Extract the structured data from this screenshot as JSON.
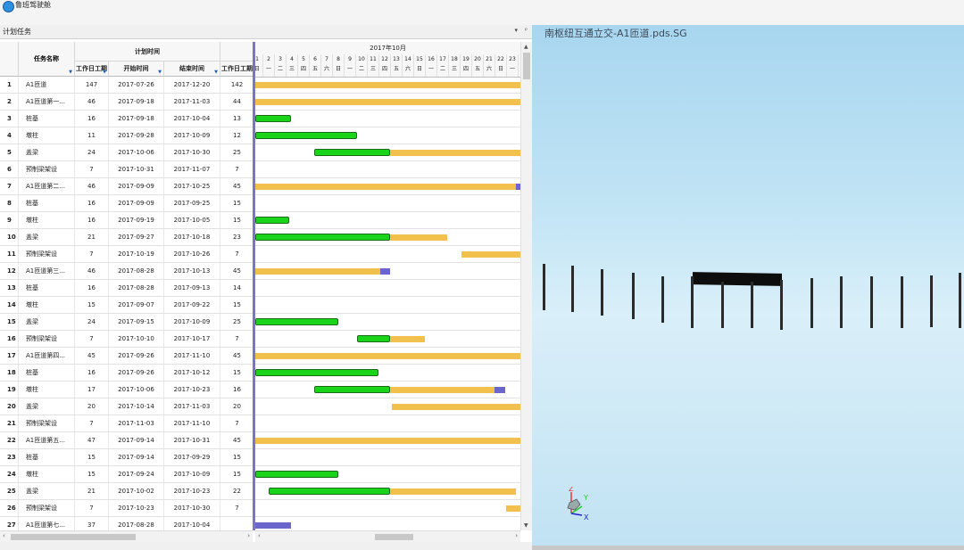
{
  "app": {
    "title": "鲁班驾驶舱"
  },
  "panel": {
    "title": "计划任务",
    "dropdown_icon": "▾",
    "pin_icon": "ᵖ"
  },
  "columns": {
    "num": "",
    "name": "任务名称",
    "plan_group": "计划时间",
    "workdays": "工作日工期",
    "start": "开始时间",
    "end": "结束时间",
    "workdays2": "工作日工期"
  },
  "rows": [
    {
      "num": "1",
      "name": "A1匝道",
      "wd": "147",
      "start": "2017-07-26",
      "end": "2017-12-20",
      "wd2": "142"
    },
    {
      "num": "2",
      "name": "A1匝道第一...",
      "wd": "46",
      "start": "2017-09-18",
      "end": "2017-11-03",
      "wd2": "44"
    },
    {
      "num": "3",
      "name": "桩基",
      "wd": "16",
      "start": "2017-09-18",
      "end": "2017-10-04",
      "wd2": "13"
    },
    {
      "num": "4",
      "name": "墩柱",
      "wd": "11",
      "start": "2017-09-28",
      "end": "2017-10-09",
      "wd2": "12"
    },
    {
      "num": "5",
      "name": "盖梁",
      "wd": "24",
      "start": "2017-10-06",
      "end": "2017-10-30",
      "wd2": "25"
    },
    {
      "num": "6",
      "name": "预制梁架设",
      "wd": "7",
      "start": "2017-10-31",
      "end": "2017-11-07",
      "wd2": "7"
    },
    {
      "num": "7",
      "name": "A1匝道第二...",
      "wd": "46",
      "start": "2017-09-09",
      "end": "2017-10-25",
      "wd2": "45"
    },
    {
      "num": "8",
      "name": "桩基",
      "wd": "16",
      "start": "2017-09-09",
      "end": "2017-09-25",
      "wd2": "15"
    },
    {
      "num": "9",
      "name": "墩柱",
      "wd": "16",
      "start": "2017-09-19",
      "end": "2017-10-05",
      "wd2": "15"
    },
    {
      "num": "10",
      "name": "盖梁",
      "wd": "21",
      "start": "2017-09-27",
      "end": "2017-10-18",
      "wd2": "23"
    },
    {
      "num": "11",
      "name": "预制梁架设",
      "wd": "7",
      "start": "2017-10-19",
      "end": "2017-10-26",
      "wd2": "7"
    },
    {
      "num": "12",
      "name": "A1匝道第三...",
      "wd": "46",
      "start": "2017-08-28",
      "end": "2017-10-13",
      "wd2": "45"
    },
    {
      "num": "13",
      "name": "桩基",
      "wd": "16",
      "start": "2017-08-28",
      "end": "2017-09-13",
      "wd2": "14"
    },
    {
      "num": "14",
      "name": "墩柱",
      "wd": "15",
      "start": "2017-09-07",
      "end": "2017-09-22",
      "wd2": "15"
    },
    {
      "num": "15",
      "name": "盖梁",
      "wd": "24",
      "start": "2017-09-15",
      "end": "2017-10-09",
      "wd2": "25"
    },
    {
      "num": "16",
      "name": "预制梁架设",
      "wd": "7",
      "start": "2017-10-10",
      "end": "2017-10-17",
      "wd2": "7"
    },
    {
      "num": "17",
      "name": "A1匝道第四...",
      "wd": "45",
      "start": "2017-09-26",
      "end": "2017-11-10",
      "wd2": "45"
    },
    {
      "num": "18",
      "name": "桩基",
      "wd": "16",
      "start": "2017-09-26",
      "end": "2017-10-12",
      "wd2": "15"
    },
    {
      "num": "19",
      "name": "墩柱",
      "wd": "17",
      "start": "2017-10-06",
      "end": "2017-10-23",
      "wd2": "16"
    },
    {
      "num": "20",
      "name": "盖梁",
      "wd": "20",
      "start": "2017-10-14",
      "end": "2017-11-03",
      "wd2": "20"
    },
    {
      "num": "21",
      "name": "预制梁架设",
      "wd": "7",
      "start": "2017-11-03",
      "end": "2017-11-10",
      "wd2": "7"
    },
    {
      "num": "22",
      "name": "A1匝道第五...",
      "wd": "47",
      "start": "2017-09-14",
      "end": "2017-10-31",
      "wd2": "45"
    },
    {
      "num": "23",
      "name": "桩基",
      "wd": "15",
      "start": "2017-09-14",
      "end": "2017-09-29",
      "wd2": "15"
    },
    {
      "num": "24",
      "name": "墩柱",
      "wd": "15",
      "start": "2017-09-24",
      "end": "2017-10-09",
      "wd2": "15"
    },
    {
      "num": "25",
      "name": "盖梁",
      "wd": "21",
      "start": "2017-10-02",
      "end": "2017-10-23",
      "wd2": "22"
    },
    {
      "num": "26",
      "name": "预制梁架设",
      "wd": "7",
      "start": "2017-10-23",
      "end": "2017-10-30",
      "wd2": "7"
    },
    {
      "num": "27",
      "name": "A1匝道第七...",
      "wd": "37",
      "start": "2017-08-28",
      "end": "2017-10-04",
      "wd2": ""
    }
  ],
  "gantt": {
    "month_label": "2017年10月",
    "days": [
      {
        "d": "1",
        "w": "日"
      },
      {
        "d": "2",
        "w": "一"
      },
      {
        "d": "3",
        "w": "二"
      },
      {
        "d": "4",
        "w": "三"
      },
      {
        "d": "5",
        "w": "四"
      },
      {
        "d": "6",
        "w": "五"
      },
      {
        "d": "7",
        "w": "六"
      },
      {
        "d": "8",
        "w": "日"
      },
      {
        "d": "9",
        "w": "一"
      },
      {
        "d": "10",
        "w": "二"
      },
      {
        "d": "11",
        "w": "三"
      },
      {
        "d": "12",
        "w": "四"
      },
      {
        "d": "13",
        "w": "五"
      },
      {
        "d": "14",
        "w": "六"
      },
      {
        "d": "15",
        "w": "日"
      },
      {
        "d": "16",
        "w": "一"
      },
      {
        "d": "17",
        "w": "二"
      },
      {
        "d": "18",
        "w": "三"
      },
      {
        "d": "19",
        "w": "四"
      },
      {
        "d": "20",
        "w": "五"
      },
      {
        "d": "21",
        "w": "六"
      },
      {
        "d": "22",
        "w": "日"
      },
      {
        "d": "23",
        "w": "一"
      }
    ],
    "legend_colors": {
      "planned": "#f2c04c",
      "actual": "#19d419",
      "delay": "#6b66cc"
    },
    "bars": [
      [
        {
          "t": "y",
          "from": 1,
          "to": 24
        }
      ],
      [
        {
          "t": "y",
          "from": 1,
          "to": 24
        }
      ],
      [
        {
          "t": "g",
          "from": 1,
          "to": 4.2
        }
      ],
      [
        {
          "t": "g",
          "from": 1,
          "to": 9.9
        }
      ],
      [
        {
          "t": "g",
          "from": 6.2,
          "to": 12.8
        },
        {
          "t": "y",
          "from": 12.8,
          "to": 24
        }
      ],
      [],
      [
        {
          "t": "y",
          "from": 1,
          "to": 23.6
        },
        {
          "t": "p",
          "from": 23.6,
          "to": 24
        }
      ],
      [],
      [
        {
          "t": "g",
          "from": 1,
          "to": 4.1
        }
      ],
      [
        {
          "t": "g",
          "from": 1,
          "to": 12.8
        },
        {
          "t": "y",
          "from": 12.8,
          "to": 17.7
        }
      ],
      [
        {
          "t": "y",
          "from": 18.9,
          "to": 24
        }
      ],
      [
        {
          "t": "y",
          "from": 1,
          "to": 11.9
        },
        {
          "t": "p",
          "from": 11.9,
          "to": 12.8
        }
      ],
      [],
      [],
      [
        {
          "t": "g",
          "from": 1,
          "to": 8.3
        }
      ],
      [
        {
          "t": "g",
          "from": 9.9,
          "to": 12.8
        },
        {
          "t": "y",
          "from": 12.8,
          "to": 15.8
        }
      ],
      [
        {
          "t": "y",
          "from": 1,
          "to": 24
        }
      ],
      [
        {
          "t": "g",
          "from": 1,
          "to": 11.8
        }
      ],
      [
        {
          "t": "g",
          "from": 6.2,
          "to": 12.8
        },
        {
          "t": "y",
          "from": 12.8,
          "to": 21.8
        },
        {
          "t": "p",
          "from": 21.8,
          "to": 22.7
        }
      ],
      [
        {
          "t": "y",
          "from": 12.9,
          "to": 24
        }
      ],
      [],
      [
        {
          "t": "y",
          "from": 1,
          "to": 24
        }
      ],
      [],
      [
        {
          "t": "g",
          "from": 1,
          "to": 8.3
        }
      ],
      [
        {
          "t": "g",
          "from": 2.3,
          "to": 12.8
        },
        {
          "t": "y",
          "from": 12.8,
          "to": 23.6
        }
      ],
      [
        {
          "t": "y",
          "from": 22.8,
          "to": 24
        }
      ],
      [
        {
          "t": "p",
          "from": 1,
          "to": 4.2
        }
      ]
    ]
  },
  "viewport": {
    "title": "南枢纽互通立交-A1匝道.pds.SG",
    "axis_labels": {
      "z": "Z",
      "y": "Y",
      "x": "X"
    }
  }
}
